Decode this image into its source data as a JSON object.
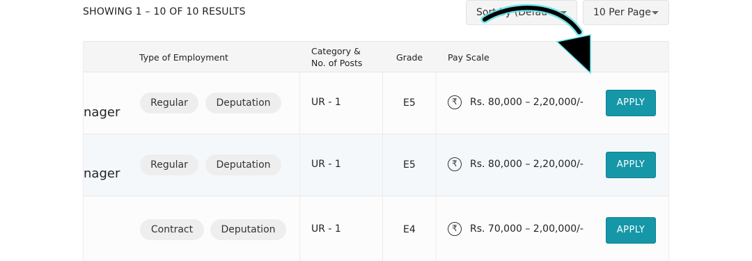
{
  "toolbar": {
    "results_label": "SHOWING 1 – 10 OF 10 RESULTS",
    "sort_label": "Sort by (Defau",
    "per_page_label": "10 Per Page"
  },
  "table": {
    "headers": {
      "employment_type": "Type of Employment",
      "category_line1": "Category &",
      "category_line2": "No. of Posts",
      "grade": "Grade",
      "pay_scale": "Pay Scale"
    },
    "rows": [
      {
        "title": "nager",
        "employment": [
          "Regular",
          "Deputation"
        ],
        "category": "UR - 1",
        "grade": "E5",
        "pay": "Rs. 80,000 – 2,20,000/-",
        "action": "APPLY"
      },
      {
        "title": "nager",
        "employment": [
          "Regular",
          "Deputation"
        ],
        "category": "UR - 1",
        "grade": "E5",
        "pay": "Rs. 80,000 – 2,20,000/-",
        "action": "APPLY"
      },
      {
        "title": "",
        "employment": [
          "Contract",
          "Deputation"
        ],
        "category": "UR - 1",
        "grade": "E4",
        "pay": "Rs. 70,000 – 2,00,000/-",
        "action": "APPLY"
      }
    ]
  },
  "colors": {
    "apply_button": "#1597a8",
    "arrow_fill": "#000000",
    "arrow_glow": "#5fe3e6"
  },
  "icons": {
    "rupee": "rupee-icon",
    "dropdown": "chevron-down-icon",
    "overlay": "arrow-annotation-icon"
  },
  "rupee_symbol": "₹"
}
